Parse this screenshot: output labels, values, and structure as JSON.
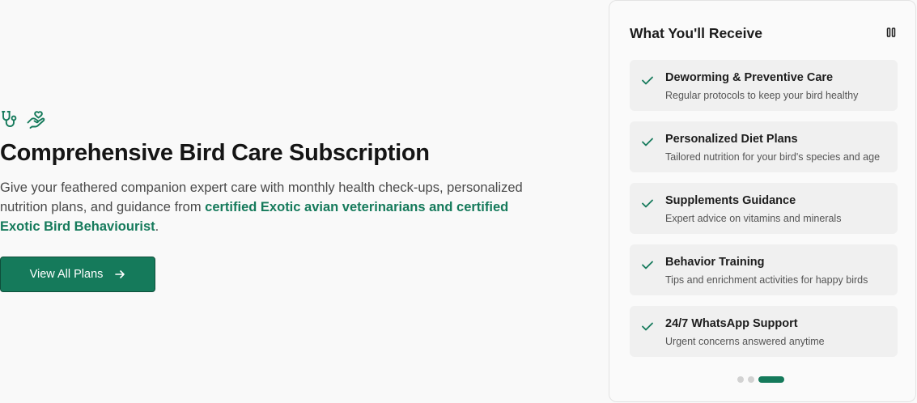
{
  "colors": {
    "accent": "#157a5b",
    "background": "#f9f9f9",
    "card_bg": "#fafafa",
    "item_bg": "#f0f0f0"
  },
  "hero": {
    "icons": [
      "stethoscope-icon",
      "hand-heart-icon"
    ],
    "title": "Comprehensive Bird Care Subscription",
    "desc_plain": "Give your feathered companion expert care with monthly health check-ups, personalized nutrition plans, and guidance from ",
    "desc_highlight": "certified Exotic avian veterinarians and certified Exotic Bird Behaviourist",
    "desc_end": ".",
    "cta_label": "View All Plans",
    "cta_icon": "arrow-right-icon"
  },
  "card": {
    "title": "What You'll Receive",
    "pause_icon": "pause-icon",
    "items": [
      {
        "title": "Deworming & Preventive Care",
        "desc": "Regular protocols to keep your bird healthy"
      },
      {
        "title": "Personalized Diet Plans",
        "desc": "Tailored nutrition for your bird's species and age"
      },
      {
        "title": "Supplements Guidance",
        "desc": "Expert advice on vitamins and minerals"
      },
      {
        "title": "Behavior Training",
        "desc": "Tips and enrichment activities for happy birds"
      },
      {
        "title": "24/7 WhatsApp Support",
        "desc": "Urgent concerns answered anytime"
      }
    ],
    "carousel": {
      "total": 3,
      "active": 3
    }
  }
}
